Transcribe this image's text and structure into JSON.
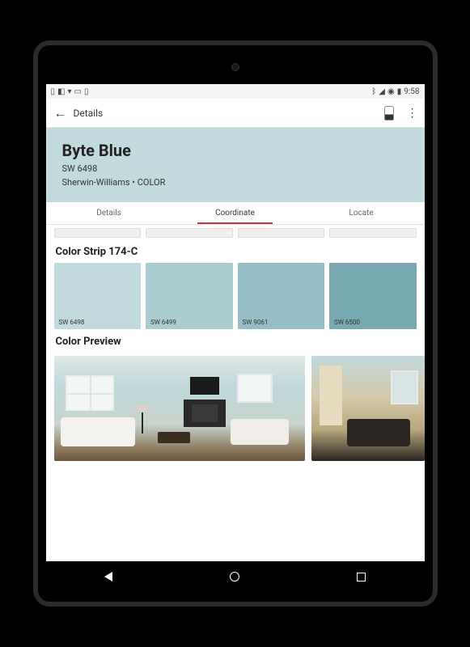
{
  "status": {
    "time": "9:58"
  },
  "header": {
    "title": "Details"
  },
  "hero": {
    "name": "Byte Blue",
    "code": "SW 6498",
    "brand": "Sherwin-Williams • COLOR",
    "bg_color": "#c1dadd"
  },
  "tabs": [
    {
      "label": "Details",
      "active": false
    },
    {
      "label": "Coordinate",
      "active": true
    },
    {
      "label": "Locate",
      "active": false
    }
  ],
  "color_strip": {
    "title": "Color Strip 174-C",
    "swatches": [
      {
        "label": "SW 6498",
        "color": "#c1dadd"
      },
      {
        "label": "SW 6499",
        "color": "#a9ccd0"
      },
      {
        "label": "SW 9061",
        "color": "#95bec6"
      },
      {
        "label": "SW 6500",
        "color": "#78a9b2"
      }
    ]
  },
  "preview": {
    "title": "Color Preview"
  }
}
